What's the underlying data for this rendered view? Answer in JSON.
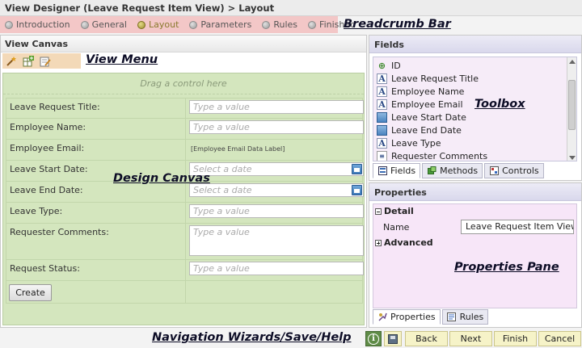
{
  "window": {
    "title": "View Designer (Leave Request Item View) > Layout"
  },
  "breadcrumb": {
    "items": [
      {
        "label": "Introduction",
        "active": false
      },
      {
        "label": "General",
        "active": false
      },
      {
        "label": "Layout",
        "active": true
      },
      {
        "label": "Parameters",
        "active": false
      },
      {
        "label": "Rules",
        "active": false
      },
      {
        "label": "Finished",
        "active": false
      }
    ]
  },
  "callouts": {
    "breadcrumb_bar": "Breadcrumb Bar",
    "view_menu": "View Menu",
    "toolbox": "Toolbox",
    "design_canvas": "Design Canvas",
    "properties_pane": "Properties Pane",
    "navigation": "Navigation Wizards/Save/Help"
  },
  "view_canvas": {
    "title": "View Canvas",
    "menu_icons": [
      "wand-icon",
      "add-table-icon",
      "edit-form-icon"
    ],
    "drag_hint": "Drag a control here",
    "rows": [
      {
        "label": "Leave Request Title:",
        "placeholder": "Type a value",
        "kind": "text"
      },
      {
        "label": "Employee Name:",
        "placeholder": "Type a value",
        "kind": "text"
      },
      {
        "label": "Employee Email:",
        "value": "[Employee Email Data Label]",
        "kind": "datalabel"
      },
      {
        "label": "Leave Start Date:",
        "placeholder": "Select a date",
        "kind": "date"
      },
      {
        "label": "Leave End Date:",
        "placeholder": "Select a date",
        "kind": "date"
      },
      {
        "label": "Leave Type:",
        "placeholder": "Type a value",
        "kind": "text"
      },
      {
        "label": "Requester Comments:",
        "placeholder": "Type a value",
        "kind": "textarea"
      },
      {
        "label": "Request Status:",
        "placeholder": "Type a value",
        "kind": "text"
      }
    ],
    "create_button": "Create"
  },
  "fields": {
    "title": "Fields",
    "items": [
      {
        "label": "ID",
        "icon": "id-field-icon"
      },
      {
        "label": "Leave Request Title",
        "icon": "text-field-icon"
      },
      {
        "label": "Employee Name",
        "icon": "text-field-icon"
      },
      {
        "label": "Employee Email",
        "icon": "text-field-icon"
      },
      {
        "label": "Leave Start Date",
        "icon": "date-field-icon"
      },
      {
        "label": "Leave End Date",
        "icon": "date-field-icon"
      },
      {
        "label": "Leave Type",
        "icon": "text-field-icon"
      },
      {
        "label": "Requester Comments",
        "icon": "memo-field-icon"
      }
    ],
    "tabs": [
      {
        "label": "Fields",
        "active": true
      },
      {
        "label": "Methods",
        "active": false
      },
      {
        "label": "Controls",
        "active": false
      }
    ]
  },
  "properties": {
    "title": "Properties",
    "detail_label": "Detail",
    "name_label": "Name",
    "name_value": "Leave Request Item View",
    "advanced_label": "Advanced",
    "tabs": [
      {
        "label": "Properties",
        "active": true
      },
      {
        "label": "Rules",
        "active": false
      }
    ]
  },
  "footer": {
    "back": "Back",
    "next": "Next",
    "finish": "Finish",
    "cancel": "Cancel"
  }
}
